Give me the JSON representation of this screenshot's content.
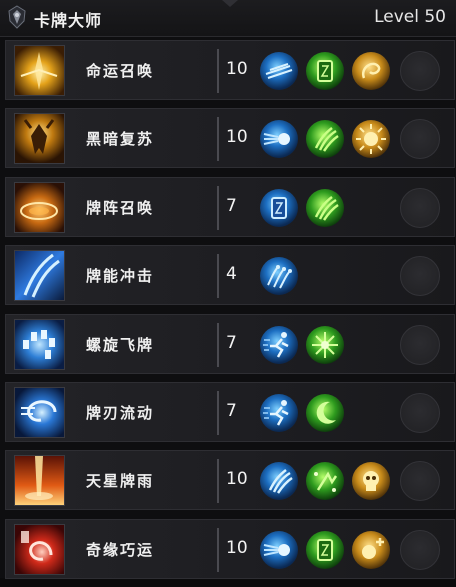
{
  "header": {
    "class_name": "卡牌大师",
    "level": "Level 50",
    "class_icon": "dark-crest-icon"
  },
  "skills": [
    {
      "name": "命运召唤",
      "points": "10",
      "icon": "golden-card-burst-icon",
      "tripods": [
        {
          "icon": "blue-dash-icon",
          "color": "blue"
        },
        {
          "icon": "green-card-icon",
          "color": "green"
        },
        {
          "icon": "gold-spiral-icon",
          "color": "gold"
        }
      ]
    },
    {
      "name": "黑暗复苏",
      "points": "10",
      "icon": "dark-demon-icon",
      "tripods": [
        {
          "icon": "blue-orb-icon",
          "color": "blue"
        },
        {
          "icon": "green-claw-icon",
          "color": "green"
        },
        {
          "icon": "gold-sun-icon",
          "color": "gold"
        }
      ]
    },
    {
      "name": "牌阵召唤",
      "points": "7",
      "icon": "card-circle-icon",
      "tripods": [
        {
          "icon": "blue-card-icon",
          "color": "blue"
        },
        {
          "icon": "green-claw-icon",
          "color": "green"
        }
      ]
    },
    {
      "name": "牌能冲击",
      "points": "4",
      "icon": "blue-slash-icon",
      "tripods": [
        {
          "icon": "blue-multi-strike-icon",
          "color": "blue"
        }
      ]
    },
    {
      "name": "螺旋飞牌",
      "points": "7",
      "icon": "card-spiral-icon",
      "tripods": [
        {
          "icon": "blue-sprint-icon",
          "color": "blue"
        },
        {
          "icon": "green-burst-icon",
          "color": "green"
        }
      ]
    },
    {
      "name": "牌刃流动",
      "points": "7",
      "icon": "blue-vortex-icon",
      "tripods": [
        {
          "icon": "blue-sprint-icon",
          "color": "blue"
        },
        {
          "icon": "green-moon-icon",
          "color": "green"
        }
      ]
    },
    {
      "name": "天星牌雨",
      "points": "10",
      "icon": "fire-pillar-icon",
      "tripods": [
        {
          "icon": "blue-claw-icon",
          "color": "blue"
        },
        {
          "icon": "green-sparkle-arrow-icon",
          "color": "green"
        },
        {
          "icon": "gold-skull-icon",
          "color": "gold"
        }
      ]
    },
    {
      "name": "奇缘巧运",
      "points": "10",
      "icon": "red-card-swirl-icon",
      "tripods": [
        {
          "icon": "blue-orb-icon",
          "color": "blue"
        },
        {
          "icon": "green-card-icon",
          "color": "green"
        },
        {
          "icon": "gold-orb-plus-icon",
          "color": "gold"
        }
      ]
    }
  ]
}
